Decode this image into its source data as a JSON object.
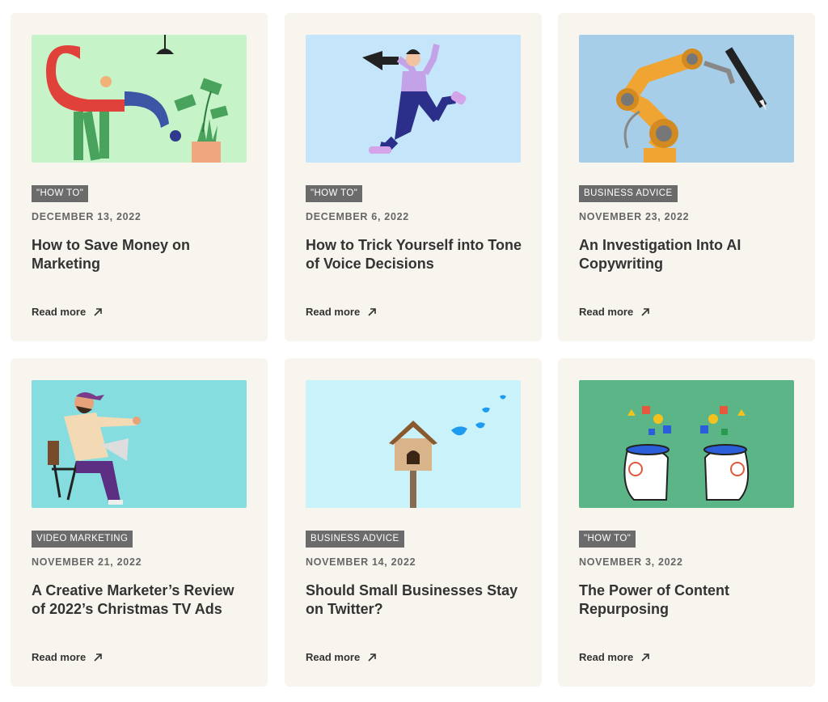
{
  "posts": [
    {
      "tag": "\"HOW TO\"",
      "date": "DECEMBER 13, 2022",
      "title": "How to Save Money on Marketing",
      "read_more": "Read more",
      "image_icon": "save-money-illustration"
    },
    {
      "tag": "\"HOW TO\"",
      "date": "DECEMBER 6, 2022",
      "title": "How to Trick Yourself into Tone of Voice Decisions",
      "read_more": "Read more",
      "image_icon": "megaphone-person-illustration"
    },
    {
      "tag": "BUSINESS ADVICE",
      "date": "NOVEMBER 23, 2022",
      "title": "An Investigation Into AI Copywriting",
      "read_more": "Read more",
      "image_icon": "robot-arm-pen-illustration"
    },
    {
      "tag": "VIDEO MARKETING",
      "date": "NOVEMBER 21, 2022",
      "title": "A Creative Marketer’s Review of 2022’s Christmas TV Ads",
      "read_more": "Read more",
      "image_icon": "director-chair-illustration"
    },
    {
      "tag": "BUSINESS ADVICE",
      "date": "NOVEMBER 14, 2022",
      "title": "Should Small Businesses Stay on Twitter?",
      "read_more": "Read more",
      "image_icon": "birdhouse-twitter-illustration"
    },
    {
      "tag": "\"HOW TO\"",
      "date": "NOVEMBER 3, 2022",
      "title": "The Power of Content Repurposing",
      "read_more": "Read more",
      "image_icon": "two-heads-ideas-illustration"
    }
  ],
  "colors": {
    "card_bg": "#f8f5ee",
    "tag_bg": "#6b6b6b",
    "text": "#333333",
    "image_bgs": [
      "#c6f3c8",
      "#c5e6fa",
      "#a6cee8",
      "#86dde0",
      "#c9f2fa",
      "#5cb587"
    ]
  }
}
